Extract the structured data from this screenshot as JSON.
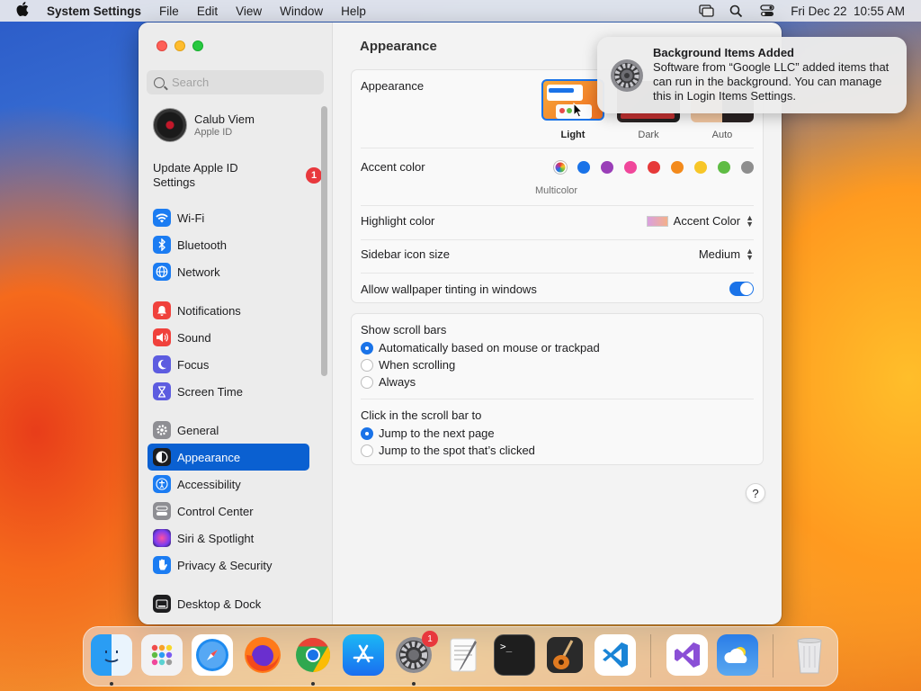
{
  "menubar": {
    "app_name": "System Settings",
    "menus": [
      "File",
      "Edit",
      "View",
      "Window",
      "Help"
    ],
    "datetime": "Fri Dec 22  10:55 AM"
  },
  "sidebar": {
    "search_placeholder": "Search",
    "account": {
      "name": "Calub Viem",
      "subtitle": "Apple ID"
    },
    "update": {
      "label": "Update Apple ID Settings",
      "badge": "1"
    },
    "items": [
      {
        "label": "Wi-Fi",
        "icon": "wifi-icon",
        "color": "#1b7cf2"
      },
      {
        "label": "Bluetooth",
        "icon": "bluetooth-icon",
        "color": "#1b7cf2"
      },
      {
        "label": "Network",
        "icon": "globe-icon",
        "color": "#1b7cf2"
      },
      {
        "label": "Notifications",
        "icon": "bell-icon",
        "color": "#f0413c"
      },
      {
        "label": "Sound",
        "icon": "speaker-icon",
        "color": "#f0413c"
      },
      {
        "label": "Focus",
        "icon": "moon-icon",
        "color": "#5d5ce0"
      },
      {
        "label": "Screen Time",
        "icon": "hourglass-icon",
        "color": "#5d5ce0"
      },
      {
        "label": "General",
        "icon": "gear-icon",
        "color": "#8e8e93"
      },
      {
        "label": "Appearance",
        "icon": "appearance-icon",
        "color": "#1d1d1f"
      },
      {
        "label": "Accessibility",
        "icon": "accessibility-icon",
        "color": "#1b7cf2"
      },
      {
        "label": "Control Center",
        "icon": "control-center-icon",
        "color": "#8e8e93"
      },
      {
        "label": "Siri & Spotlight",
        "icon": "siri-icon",
        "color": "#b43fd6"
      },
      {
        "label": "Privacy & Security",
        "icon": "hand-icon",
        "color": "#1b7cf2"
      },
      {
        "label": "Desktop & Dock",
        "icon": "dock-icon",
        "color": "#1d1d1f"
      }
    ]
  },
  "content": {
    "title": "Appearance",
    "appearance": {
      "label": "Appearance",
      "options": [
        "Light",
        "Dark",
        "Auto"
      ],
      "selected": "Light"
    },
    "accent": {
      "label": "Accent color",
      "selected_name": "Multicolor",
      "colors": [
        "#1a73e8",
        "#9a3fb8",
        "#f0479b",
        "#e63a3a",
        "#f38a1c",
        "#f7c628",
        "#5fbc44",
        "#8e8e8e"
      ]
    },
    "highlight": {
      "label": "Highlight color",
      "value": "Accent Color"
    },
    "sidebar_icon": {
      "label": "Sidebar icon size",
      "value": "Medium"
    },
    "tinting": {
      "label": "Allow wallpaper tinting in windows",
      "on": true
    },
    "scroll_bars": {
      "label": "Show scroll bars",
      "options": [
        "Automatically based on mouse or trackpad",
        "When scrolling",
        "Always"
      ],
      "selected": 0
    },
    "click_scroll": {
      "label": "Click in the scroll bar to",
      "options": [
        "Jump to the next page",
        "Jump to the spot that’s clicked"
      ],
      "selected": 0
    },
    "help": "?"
  },
  "notification": {
    "title": "Background Items Added",
    "body": "Software from “Google LLC” added items that can run in the background. You can manage this in Login Items Settings."
  },
  "dock": {
    "badge": "1",
    "apps": [
      "Finder",
      "Launchpad",
      "Safari",
      "Firefox",
      "Chrome",
      "App Store",
      "System Settings",
      "TextEdit",
      "Terminal",
      "GarageBand",
      "VS Code",
      "Visual Studio",
      "Weather",
      "Trash"
    ]
  }
}
